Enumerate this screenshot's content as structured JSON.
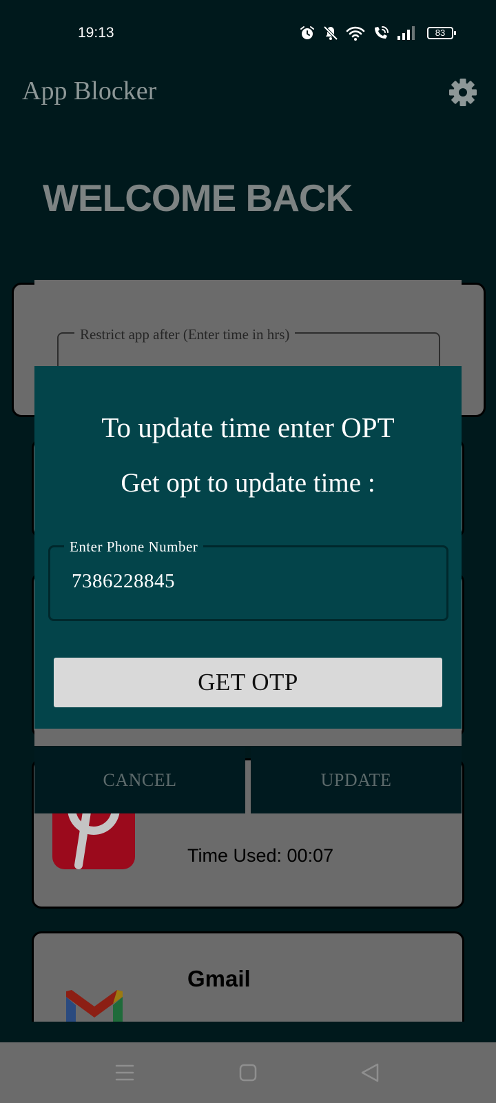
{
  "status_bar": {
    "time": "19:13",
    "battery_level": "83",
    "icons": [
      "alarm-icon",
      "mute-icon",
      "wifi-icon",
      "wifi-calling-icon",
      "signal-icon",
      "battery-icon"
    ]
  },
  "app_bar": {
    "title": "App Blocker",
    "settings_icon": "gear-icon"
  },
  "welcome_text": "WELCOME BACK",
  "restrict_dialog": {
    "field_label": "Restrict app after (Enter time in hrs)",
    "cancel_label": "CANCEL",
    "update_label": "UPDATE"
  },
  "otp_dialog": {
    "title": "To update time enter OPT",
    "subtitle": "Get opt to update time :",
    "phone_label": "Enter Phone Number",
    "phone_value": "7386228845",
    "button_label": "GET OTP"
  },
  "apps": [
    {
      "icon": "pinterest-icon",
      "time_used": "Time Used: 00:07"
    },
    {
      "icon": "gmail-icon",
      "name": "Gmail"
    }
  ],
  "nav_bar": {
    "icons": [
      "menu-icon",
      "home-icon",
      "back-icon"
    ]
  },
  "colors": {
    "background": "#00191c",
    "dialog_teal": "#03444a",
    "dim_gray": "#6b6b6b",
    "button_gray": "#d9d9d9"
  }
}
